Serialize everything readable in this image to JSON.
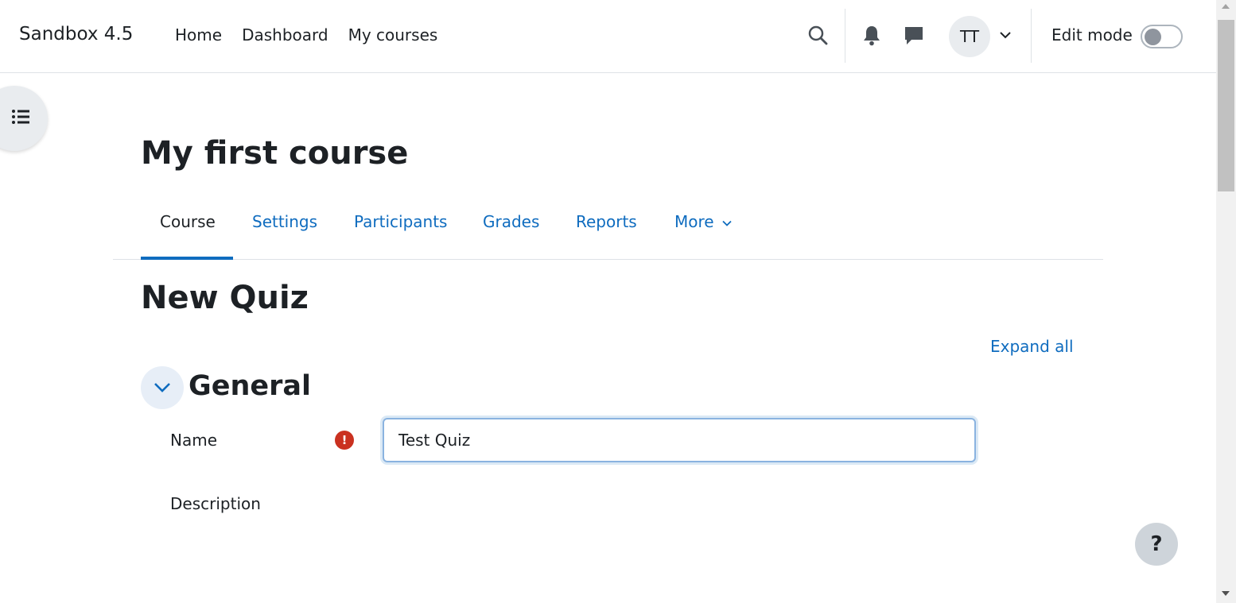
{
  "navbar": {
    "brand": "Sandbox 4.5",
    "links": [
      "Home",
      "Dashboard",
      "My courses"
    ],
    "avatar_initials": "TT",
    "edit_mode_label": "Edit mode",
    "edit_mode_on": false,
    "icons": [
      "search-icon",
      "bell-icon",
      "message-icon",
      "chevron-down-icon"
    ]
  },
  "course": {
    "title": "My first course",
    "tabs": [
      {
        "label": "Course",
        "active": true
      },
      {
        "label": "Settings",
        "active": false
      },
      {
        "label": "Participants",
        "active": false
      },
      {
        "label": "Grades",
        "active": false
      },
      {
        "label": "Reports",
        "active": false
      },
      {
        "label": "More",
        "active": false
      }
    ]
  },
  "form": {
    "heading": "New Quiz",
    "expand_all": "Expand all",
    "section_title": "General",
    "name_label": "Name",
    "name_value": "Test Quiz",
    "required_mark": "!",
    "description_label": "Description"
  },
  "help_button": "?",
  "colors": {
    "link": "#0f6cbf",
    "text": "#1d2125",
    "required": "#ca3120"
  }
}
